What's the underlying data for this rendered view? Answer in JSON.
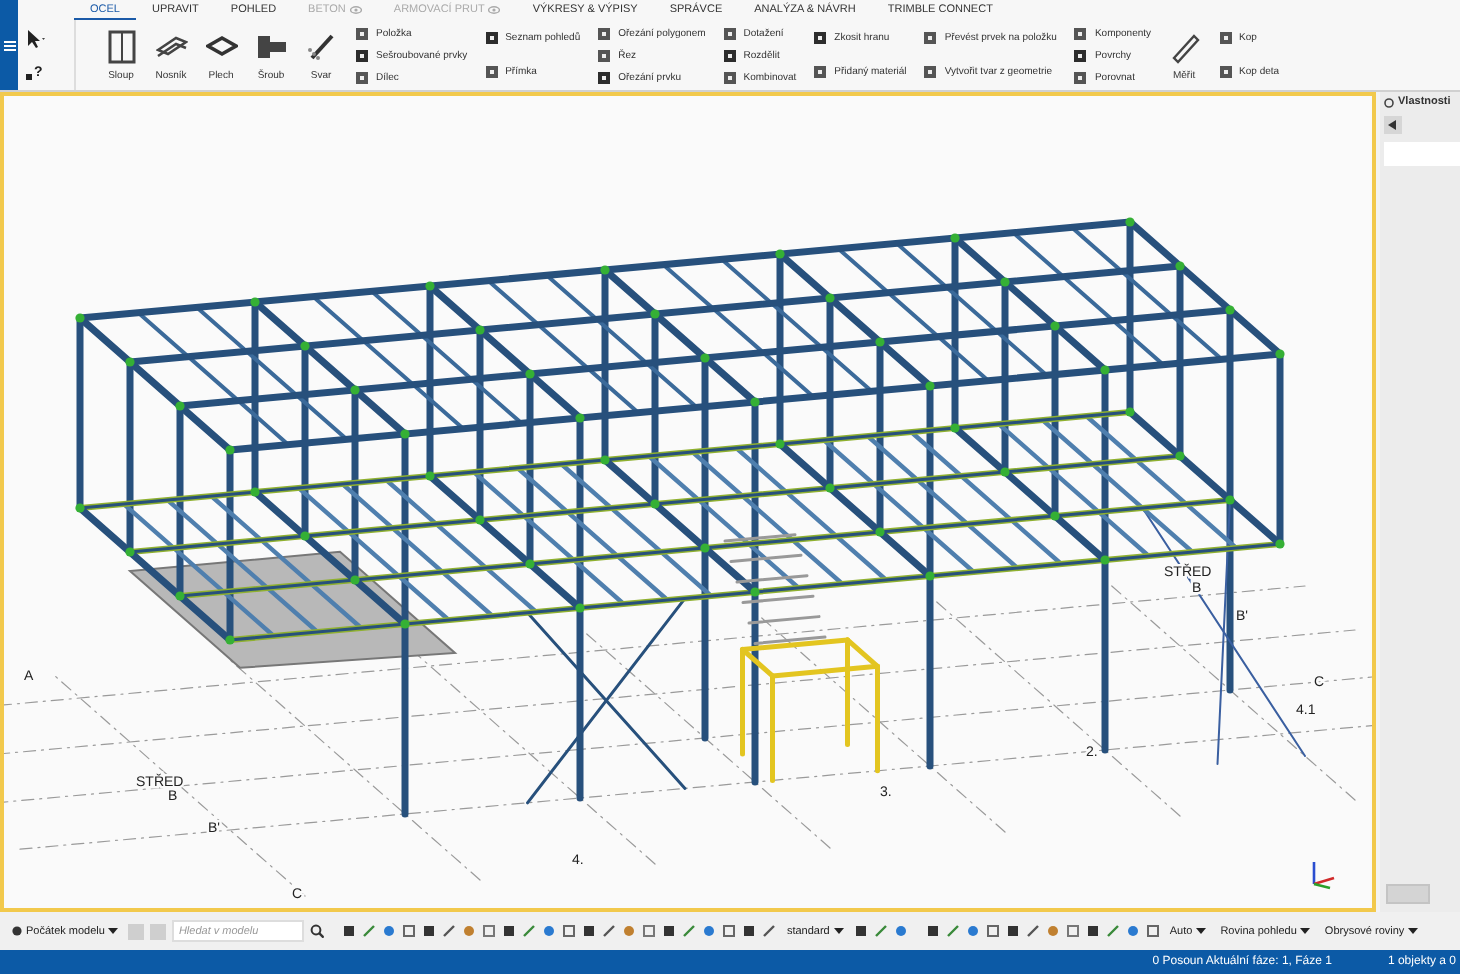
{
  "help_button": "?",
  "tabs": [
    {
      "label": "OCEL",
      "selected": true,
      "disabled": false
    },
    {
      "label": "UPRAVIT",
      "selected": false,
      "disabled": false
    },
    {
      "label": "POHLED",
      "selected": false,
      "disabled": false
    },
    {
      "label": "BETON",
      "selected": false,
      "disabled": true
    },
    {
      "label": "ARMOVACÍ PRUT",
      "selected": false,
      "disabled": true
    },
    {
      "label": "VÝKRESY & VÝPISY",
      "selected": false,
      "disabled": false
    },
    {
      "label": "SPRÁVCE",
      "selected": false,
      "disabled": false
    },
    {
      "label": "ANALÝZA & NÁVRH",
      "selected": false,
      "disabled": false
    },
    {
      "label": "TRIMBLE CONNECT",
      "selected": false,
      "disabled": false
    }
  ],
  "ribbon": [
    {
      "kind": "large",
      "label": "Sloup"
    },
    {
      "kind": "large",
      "label": "Nosník"
    },
    {
      "kind": "large",
      "label": "Plech"
    },
    {
      "kind": "large",
      "label": "Šroub"
    },
    {
      "kind": "large",
      "label": "Svar"
    },
    {
      "kind": "stack",
      "items": [
        "Položka",
        "Sešroubované prvky",
        "Dílec"
      ]
    },
    {
      "kind": "stack",
      "items": [
        "Seznam pohledů",
        "Přímka"
      ]
    },
    {
      "kind": "stack",
      "items": [
        "Ořezání polygonem",
        "Řez",
        "Ořezání prvku"
      ]
    },
    {
      "kind": "stack",
      "items": [
        "Dotažení",
        "Rozdělit",
        "Kombinovat"
      ]
    },
    {
      "kind": "stack",
      "items": [
        "Zkosit hranu",
        "Přidaný materiál"
      ]
    },
    {
      "kind": "stack",
      "items": [
        "Převést prvek na položku",
        "Vytvořit tvar z geometrie"
      ]
    },
    {
      "kind": "stack",
      "items": [
        "Komponenty",
        "Povrchy",
        "Porovnat"
      ]
    },
    {
      "kind": "large",
      "label": "Měřit"
    },
    {
      "kind": "stack",
      "items": [
        "Kop",
        "Kop deta"
      ]
    }
  ],
  "viewport": {
    "grid_labels": [
      "A",
      "STŘED",
      "B",
      "B'",
      "C",
      "STŘED",
      "B",
      "B'",
      "C",
      "4.1",
      "2.",
      "3.",
      "4."
    ]
  },
  "properties_panel": {
    "title": "Vlastnosti"
  },
  "toolbar": {
    "origin": "Počátek modelu",
    "search": {
      "placeholder": "Hledat v modelu"
    },
    "dropdowns": [
      "standard",
      "Auto",
      "Rovina pohledu",
      "Obrysové roviny"
    ]
  },
  "status_bar": {
    "phase": "0 Posoun Aktuální fáze: 1, Fáze 1",
    "selection": "1 objekty a 0"
  }
}
